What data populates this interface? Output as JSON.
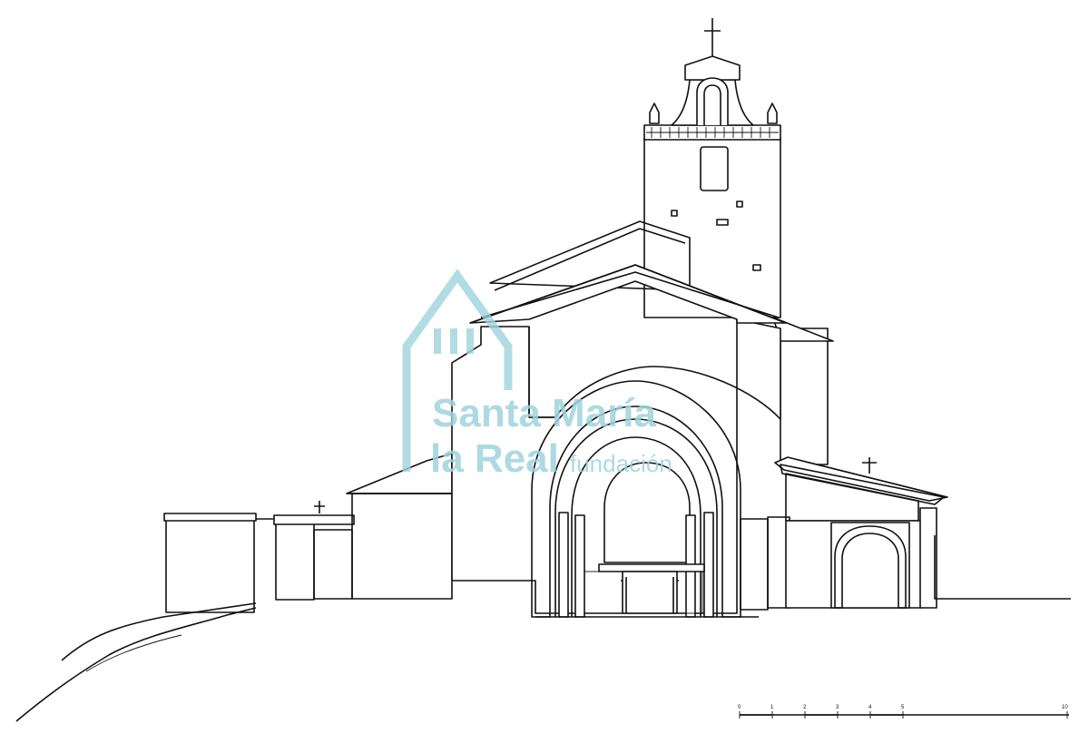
{
  "watermark": {
    "line1": "Santa María",
    "line2": "la Real",
    "line3": "fundación",
    "color": "#9fd3dd"
  },
  "scale_bar": {
    "labels": [
      "0",
      "1",
      "2",
      "3",
      "4",
      "5",
      "10"
    ]
  },
  "colors": {
    "ink": "#111111",
    "paper": "#ffffff"
  }
}
